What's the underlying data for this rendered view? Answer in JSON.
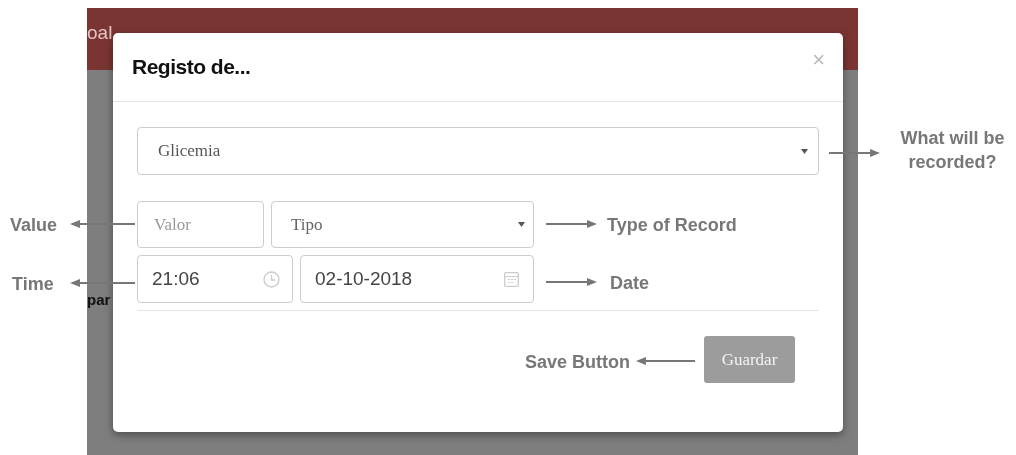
{
  "background_page": {
    "nav_items": [
      "oal"
    ],
    "side_text": "par"
  },
  "dialog": {
    "title": "Registo de...",
    "close": "×",
    "record_select": {
      "value": "Glicemia"
    },
    "value_field": {
      "placeholder": "Valor"
    },
    "type_select": {
      "placeholder": "Tipo"
    },
    "time_field": {
      "value": "21:06"
    },
    "date_field": {
      "value": "02-10-2018"
    },
    "save_button": {
      "label": "Guardar",
      "disabled": true
    }
  },
  "annotations": [
    {
      "text": "What will be recorded?",
      "points_left": false
    },
    {
      "text": "Type of Record",
      "points_left": false
    },
    {
      "text": "Date",
      "points_left": false
    },
    {
      "text": "Save Button",
      "points_left": true
    },
    {
      "text": "Value",
      "points_left": true
    },
    {
      "text": "Time",
      "points_left": true
    }
  ]
}
